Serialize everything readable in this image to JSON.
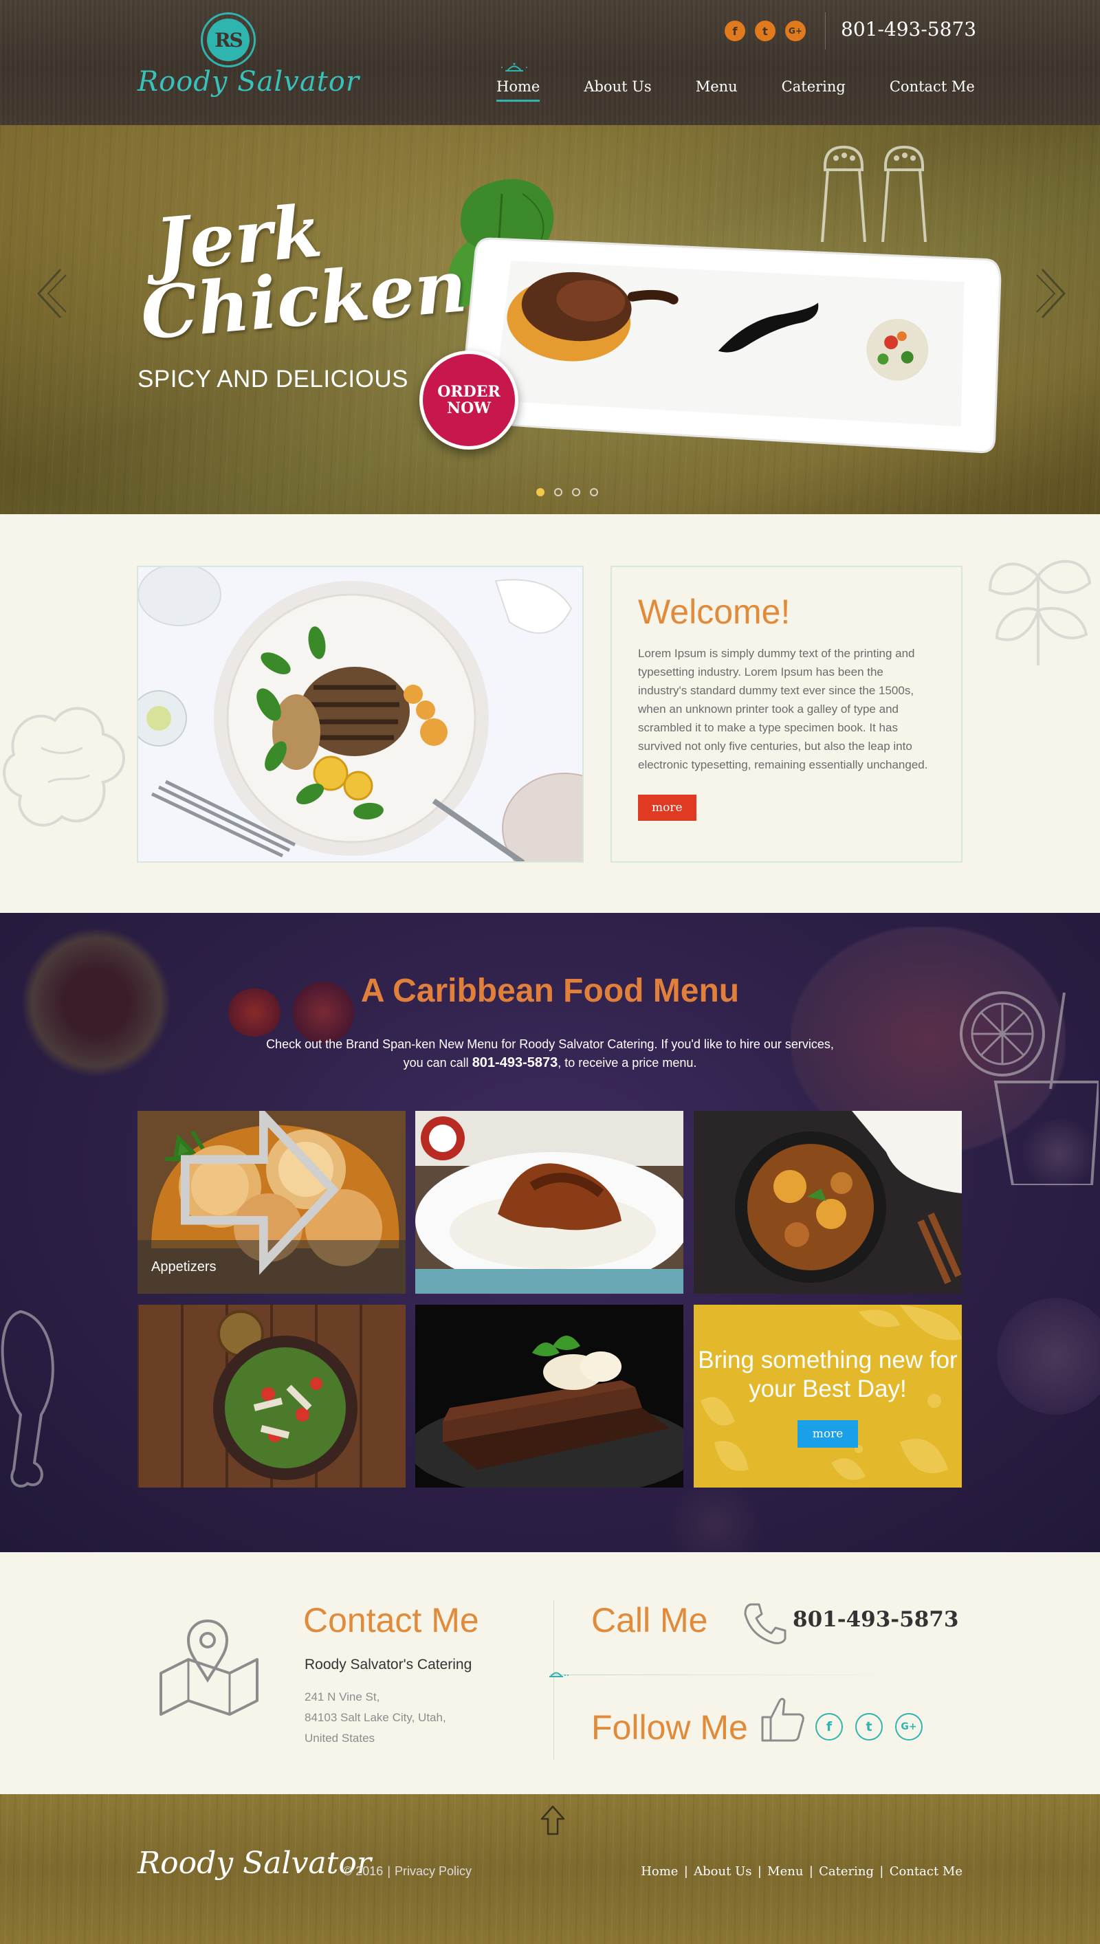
{
  "header": {
    "logo_initials": "RS",
    "logo_text": "Roody Salvator",
    "phone": "801-493-5873",
    "social": [
      {
        "icon": "facebook-icon",
        "glyph": "f"
      },
      {
        "icon": "twitter-icon",
        "glyph": "t"
      },
      {
        "icon": "google-plus-icon",
        "glyph": "G+"
      }
    ],
    "nav": [
      "Home",
      "About Us",
      "Menu",
      "Catering",
      "Contact Me"
    ],
    "active_nav": "Home"
  },
  "hero": {
    "title_line1": "Jerk",
    "title_line2": "Chicken",
    "subtitle": "SPICY AND DELICIOUS",
    "order_line1": "ORDER",
    "order_line2": "NOW",
    "slides_total": 4,
    "active_slide": 1
  },
  "welcome": {
    "title": "Welcome!",
    "text": "Lorem Ipsum is simply dummy text of the printing and typesetting industry. Lorem Ipsum has been the industry's standard dummy text ever since the 1500s, when an unknown printer took a galley of type and scrambled it to make a type specimen book. It has survived not only five centuries, but also the leap into electronic typesetting, remaining essentially unchanged.",
    "button": "more"
  },
  "menu": {
    "title": "A Caribbean Food Menu",
    "desc_line1": "Check out the Brand Span-ken New Menu for Roody Salvator Catering.  If you'd like to hire our services,",
    "desc_prefix": "you can call ",
    "desc_phone": "801-493-5873",
    "desc_suffix": ", to receive a price menu.",
    "tile_label": "Appetizers",
    "promo_text": "Bring something new for your Best Day!",
    "promo_button": "more"
  },
  "contact": {
    "title": "Contact Me",
    "company": "Roody Salvator's Catering",
    "address1": "241 N Vine St,",
    "address2": "84103 Salt Lake City, Utah,",
    "address3": "United States",
    "call_title": "Call Me",
    "phone": "801-493-5873",
    "follow_title": "Follow Me",
    "social": [
      {
        "icon": "facebook-icon",
        "glyph": "f"
      },
      {
        "icon": "twitter-icon",
        "glyph": "t"
      },
      {
        "icon": "google-plus-icon",
        "glyph": "G+"
      }
    ]
  },
  "footer": {
    "logo_text": "Roody Salvator",
    "copyright": "© 2016",
    "privacy": "Privacy Policy",
    "nav": [
      "Home",
      "About Us",
      "Menu",
      "Catering",
      "Contact Me"
    ]
  },
  "colors": {
    "accent_teal": "#2fb5b0",
    "accent_orange": "#e08a3a",
    "order_red": "#c8174c",
    "button_red": "#e03a23",
    "promo_yellow": "#e3b92b",
    "promo_button_blue": "#1aa0e8",
    "menu_purple": "#2f2149"
  }
}
